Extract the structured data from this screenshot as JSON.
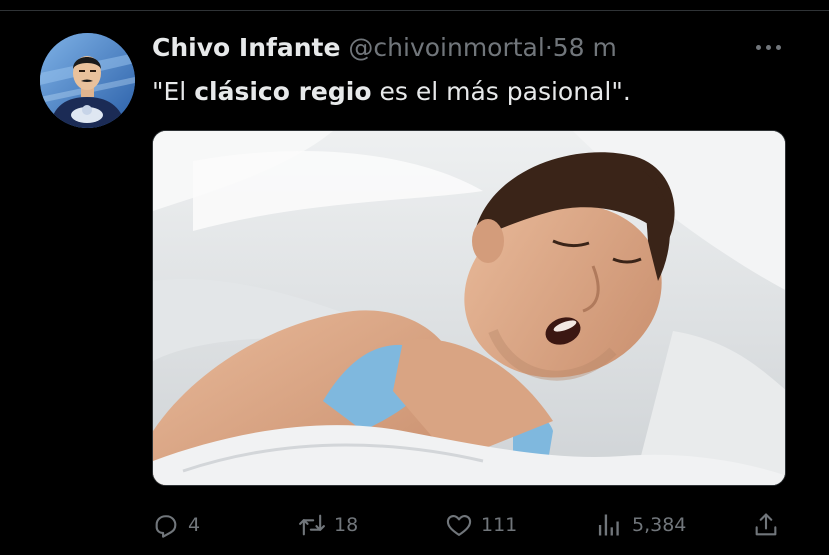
{
  "tweet": {
    "display_name": "Chivo Infante",
    "handle": "@chivoinmortal",
    "separator": "·",
    "time": "58 m",
    "text_open": "\"El ",
    "text_bold": "clásico regio",
    "text_close": " es el más pasional\".",
    "more_icon": "more-dots-icon"
  },
  "actions": {
    "replies": "4",
    "retweets": "18",
    "likes": "111",
    "views": "5,384"
  },
  "colors": {
    "background": "#000000",
    "text_primary": "#e7e9ea",
    "text_secondary": "#71767b",
    "divider": "#2f3336"
  }
}
